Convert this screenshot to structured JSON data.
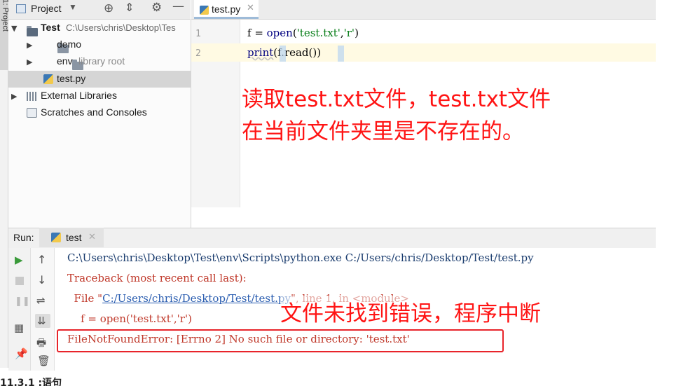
{
  "sidebar_strip": {
    "label": "1: Project"
  },
  "project_panel": {
    "title": "Project",
    "tree": [
      {
        "label": "Test",
        "hint": "C:\\Users\\chris\\Desktop\\Tes"
      },
      {
        "label": "demo"
      },
      {
        "label": "env",
        "hint": "library root"
      },
      {
        "label": "test.py"
      },
      {
        "label": "External Libraries"
      },
      {
        "label": "Scratches and Consoles"
      }
    ]
  },
  "editor": {
    "tab_label": "test.py",
    "line_numbers": [
      "1",
      "2"
    ],
    "line1": {
      "a": "f = ",
      "fn": "open",
      "b": "(",
      "s1": "'test.txt'",
      "c": ",",
      "s2": "'r'",
      "d": ")"
    },
    "line2": {
      "fn": "print",
      "a": "(f.read())"
    },
    "annotation_line1": "读取test.txt文件，test.txt文件",
    "annotation_line2": "在当前文件夹里是不存在的。"
  },
  "run_panel": {
    "label": "Run:",
    "tab_label": "test",
    "console": {
      "cmd": "C:\\Users\\chris\\Desktop\\Test\\env\\Scripts\\python.exe C:/Users/chris/Desktop/Test/test.py",
      "traceback": "Traceback (most recent call last):",
      "file_prefix": "  File \"",
      "file_link": "C:/Users/chris/Desktop/Test/test.py",
      "file_suffix": "\", line 1, in <module>",
      "code_line": "    f = open('test.txt','r')",
      "error": "FileNotFoundError: [Errno 2] No such file or directory: 'test.txt'"
    },
    "annotation": "文件未找到错误，程序中断"
  },
  "bottom_text": "11.3.1            :语句",
  "colors": {
    "annotation_red": "#ff1414",
    "error_text": "#c0392b",
    "highlight_line": "#fffae3"
  }
}
